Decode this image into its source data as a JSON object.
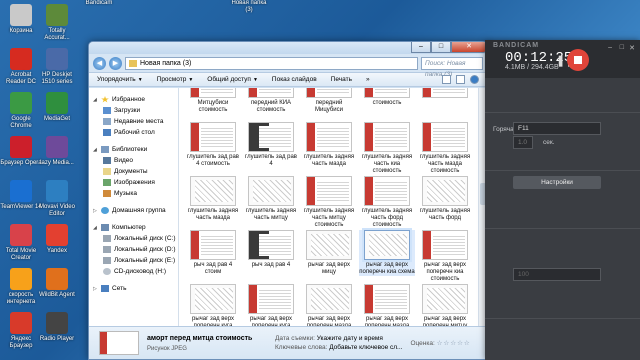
{
  "desktop": {
    "icons_col1": [
      {
        "label": "Корзина",
        "color": "#c9c9c9"
      },
      {
        "label": "Acrobat Reader DC",
        "color": "#d62b20"
      },
      {
        "label": "Google Chrome",
        "color": "#3b9a44"
      },
      {
        "label": "Браузер Opera",
        "color": "#cc1f2b"
      },
      {
        "label": "TeamViewer 14",
        "color": "#1a6fd1"
      },
      {
        "label": "Total Movie Creator",
        "color": "#d8424a"
      },
      {
        "label": "скорость интернета",
        "color": "#f7a11a"
      },
      {
        "label": "Яндекс Браузер",
        "color": "#d83a2a"
      }
    ],
    "icons_col2": [
      {
        "label": "Totally Accurat...",
        "color": "#5d8a3a"
      },
      {
        "label": "HP Deskjet 1510 series",
        "color": "#4a6aa8"
      },
      {
        "label": "MediaGet",
        "color": "#2f8f3e"
      },
      {
        "label": "lazy Media...",
        "color": "#6e4a9a"
      },
      {
        "label": "Movavi Video Editor",
        "color": "#2d7fc1"
      },
      {
        "label": "Yandex",
        "color": "#e34030"
      },
      {
        "label": "WildBit Agent",
        "color": "#e0701c"
      },
      {
        "label": "Radio Player",
        "color": "#444"
      }
    ],
    "icons_top": [
      {
        "label": "Bandicam",
        "color": "#3a3a3a"
      },
      {
        "label": "Новая папка (3)",
        "color": "#e8c35a"
      }
    ]
  },
  "explorer": {
    "title": "Новая папка (3)",
    "nav": {
      "back": "◀",
      "forward": "▶"
    },
    "address": "Новая папка (3)",
    "search_placeholder": "Поиск: Новая папка (3)",
    "commands": [
      "Упорядочить",
      "Просмотр",
      "Общий доступ",
      "Показ слайдов",
      "Печать"
    ],
    "more": "»",
    "navpane": {
      "favorites": "Избранное",
      "favorites_items": [
        "Загрузки",
        "Недавние места",
        "Рабочий стол"
      ],
      "libraries": "Библиотеки",
      "libraries_items": [
        "Видео",
        "Документы",
        "Изображения",
        "Музыка"
      ],
      "homegroup": "Домашняя группа",
      "computer": "Компьютер",
      "computer_items": [
        "Локальный диск (C:)",
        "Локальный диск (D:)",
        "Локальный диск (E:)",
        "CD-дисковод (H:)"
      ],
      "network": "Сеть"
    },
    "files": [
      {
        "label": "Митцубиси стоимость",
        "kind": "doc"
      },
      {
        "label": "передний КИА стоимость",
        "kind": "doc"
      },
      {
        "label": "передний Мицубиси",
        "kind": "doc"
      },
      {
        "label": "стоимость",
        "kind": "doc"
      },
      {
        "label": "",
        "kind": "doc"
      },
      {
        "label": "глушитель зад рав 4 стоимость",
        "kind": "doc"
      },
      {
        "label": "глушитель зад рав 4",
        "kind": "photo"
      },
      {
        "label": "глушитель задняя часть мазда",
        "kind": "doc"
      },
      {
        "label": "глушитель задняя часть киа стоимость",
        "kind": "doc"
      },
      {
        "label": "глушитель задняя часть мазда стоимость",
        "kind": "doc"
      },
      {
        "label": "глушитель задняя часть мазда",
        "kind": "diagram"
      },
      {
        "label": "глушитель задняя часть митцу",
        "kind": "diagram"
      },
      {
        "label": "глушитель задняя часть митцу стоимость",
        "kind": "doc"
      },
      {
        "label": "глушитель задняя часть форд стоимость",
        "kind": "doc"
      },
      {
        "label": "глушитель задняя часть форд",
        "kind": "diagram"
      },
      {
        "label": "рыч зад рав 4 стоим",
        "kind": "doc"
      },
      {
        "label": "рыч зад рав 4",
        "kind": "photo"
      },
      {
        "label": "рычаг зад верх мицу",
        "kind": "diagram"
      },
      {
        "label": "рычаг зад верх поперечн киа схема",
        "kind": "diagram"
      },
      {
        "label": "рычаг зад верх поперечн киа стоимость",
        "kind": "doc"
      },
      {
        "label": "рычаг зад верх поперечн куга",
        "kind": "diagram"
      },
      {
        "label": "рычаг зад верх поперечн куга стоимость",
        "kind": "doc"
      },
      {
        "label": "рычаг зад верх поперечн мазда",
        "kind": "diagram"
      },
      {
        "label": "рычаг зад верх поперечн мазда стоимость",
        "kind": "doc"
      },
      {
        "label": "рычаг зад верх поперечн митцу схема",
        "kind": "diagram"
      }
    ],
    "details": {
      "name": "аморт перед митца стоимость",
      "type": "Рисунок JPEG",
      "date_label": "Дата съемки:",
      "date_value": "Укажите дату и время",
      "tags_label": "Ключевые слова:",
      "tags_value": "Добавьте ключевое сл...",
      "rating_label": "Оценка:",
      "rating_value": "☆☆☆☆☆"
    }
  },
  "recorder": {
    "brand": "BANDICAM",
    "time": "00:12:25",
    "size": "4.1MB / 294.4GB",
    "hotkey_label": "Горячая клавиша",
    "hotkey_value": "F11",
    "delay_unit": "сек.",
    "delay_value": "1.0",
    "settings_button": "Настройки",
    "extra_value": "100"
  }
}
